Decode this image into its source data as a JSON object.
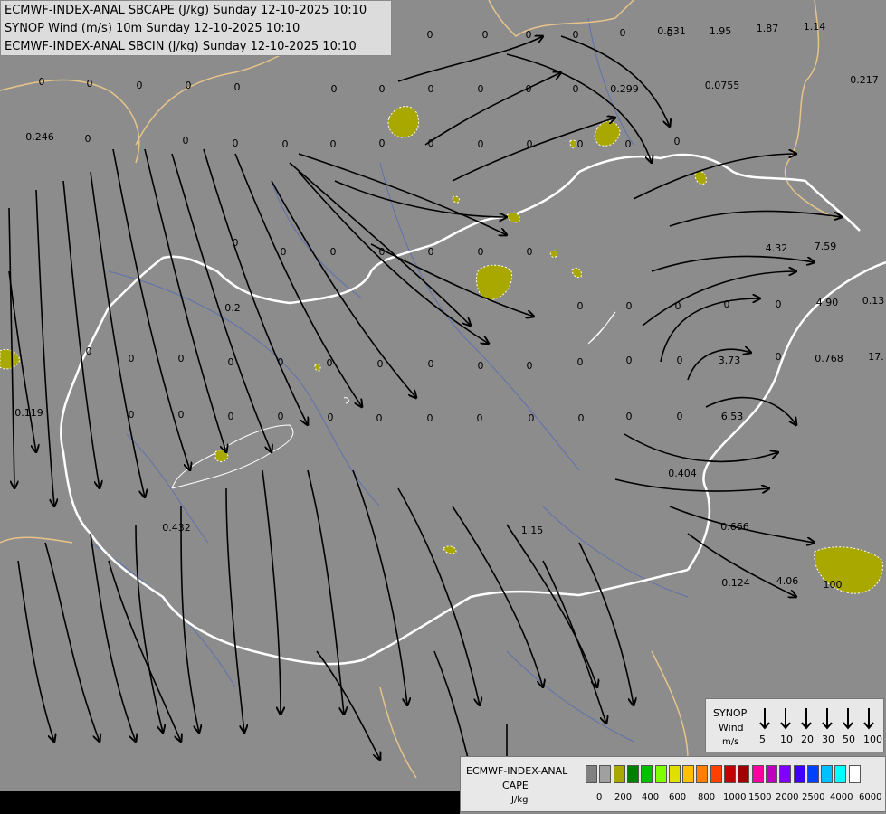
{
  "titles": {
    "line1": "ECMWF-INDEX-ANAL SBCAPE (J/kg) Sunday 12-10-2025 10:10",
    "line2": "SYNOP Wind (m/s) 10m Sunday 12-10-2025 10:10",
    "line3": "ECMWF-INDEX-ANAL SBCIN (J/kg) Sunday 12-10-2025 10:10"
  },
  "colors": {
    "background": "#8c8c8c",
    "cape_blob": "#a8a800",
    "border": "#ffffff",
    "coast": "#e6c48a",
    "river": "#5a6fb0",
    "streamline": "#000000"
  },
  "synop_legend": {
    "title": "SYNOP",
    "subtitle": "Wind",
    "unit": "m/s",
    "speeds": [
      "5",
      "10",
      "20",
      "30",
      "50",
      "100"
    ]
  },
  "cape_legend": {
    "title1": "ECMWF-INDEX-ANAL",
    "title2": "CAPE",
    "unit": "J/kg",
    "colors": [
      "#808080",
      "#a0a0a0",
      "#a8a800",
      "#008000",
      "#00c000",
      "#80ff00",
      "#e0e000",
      "#ffc000",
      "#ff8000",
      "#ff4000",
      "#c00000",
      "#a00000",
      "#ff00a0",
      "#c000c0",
      "#8000ff",
      "#4000ff",
      "#0040ff",
      "#00c0ff",
      "#00ffff",
      "#ffffff"
    ],
    "ticks": [
      "0",
      "200",
      "400",
      "600",
      "800",
      "1000",
      "1500",
      "2000",
      "2500",
      "4000",
      "6000"
    ]
  },
  "value_labels": [
    {
      "t": "0"
    },
    {
      "t": "0"
    },
    {
      "t": "0"
    },
    {
      "t": "0"
    },
    {
      "t": "0"
    },
    {
      "t": "0"
    },
    {
      "t": "0.531"
    },
    {
      "t": "1.95"
    },
    {
      "t": "1.87"
    },
    {
      "t": "1.14"
    },
    {
      "t": "0"
    },
    {
      "t": "0"
    },
    {
      "t": "0"
    },
    {
      "t": "0"
    },
    {
      "t": "0"
    },
    {
      "t": "0"
    },
    {
      "t": "0"
    },
    {
      "t": "0"
    },
    {
      "t": "0"
    },
    {
      "t": "0"
    },
    {
      "t": "0"
    },
    {
      "t": "0.299"
    },
    {
      "t": "0.0755"
    },
    {
      "t": "0.217"
    },
    {
      "t": "0.246"
    },
    {
      "t": "0"
    },
    {
      "t": "0"
    },
    {
      "t": "0"
    },
    {
      "t": "0"
    },
    {
      "t": "0"
    },
    {
      "t": "0"
    },
    {
      "t": "0"
    },
    {
      "t": "0"
    },
    {
      "t": "0"
    },
    {
      "t": "0"
    },
    {
      "t": "0"
    },
    {
      "t": "0"
    },
    {
      "t": "4.32"
    },
    {
      "t": "7.59"
    },
    {
      "t": "4.90"
    },
    {
      "t": "0.13"
    },
    {
      "t": "0.2"
    },
    {
      "t": "3.73"
    },
    {
      "t": "0.768"
    },
    {
      "t": "17."
    },
    {
      "t": "0.119"
    },
    {
      "t": "6.53"
    },
    {
      "t": "0.404"
    },
    {
      "t": "0.432"
    },
    {
      "t": "1.15"
    },
    {
      "t": "0.666"
    },
    {
      "t": "0.124"
    },
    {
      "t": "4.06"
    },
    {
      "t": "100"
    },
    {
      "t": "0"
    },
    {
      "t": "0"
    },
    {
      "t": "0"
    },
    {
      "t": "0"
    },
    {
      "t": "0"
    },
    {
      "t": "0"
    },
    {
      "t": "0"
    },
    {
      "t": "0"
    },
    {
      "t": "0"
    },
    {
      "t": "0"
    },
    {
      "t": "0"
    },
    {
      "t": "0"
    },
    {
      "t": "0"
    },
    {
      "t": "0"
    },
    {
      "t": "0"
    },
    {
      "t": "0"
    },
    {
      "t": "0"
    },
    {
      "t": "0"
    },
    {
      "t": "0"
    },
    {
      "t": "0"
    },
    {
      "t": "0"
    },
    {
      "t": "0"
    },
    {
      "t": "0"
    },
    {
      "t": "0"
    },
    {
      "t": "0"
    },
    {
      "t": "0"
    },
    {
      "t": "0"
    },
    {
      "t": "0"
    },
    {
      "t": "0"
    },
    {
      "t": "0"
    },
    {
      "t": "0"
    },
    {
      "t": "0"
    },
    {
      "t": "0"
    },
    {
      "t": "0"
    },
    {
      "t": "0"
    },
    {
      "t": "0"
    },
    {
      "t": "0"
    },
    {
      "t": "0"
    },
    {
      "t": "0"
    },
    {
      "t": "0"
    }
  ]
}
